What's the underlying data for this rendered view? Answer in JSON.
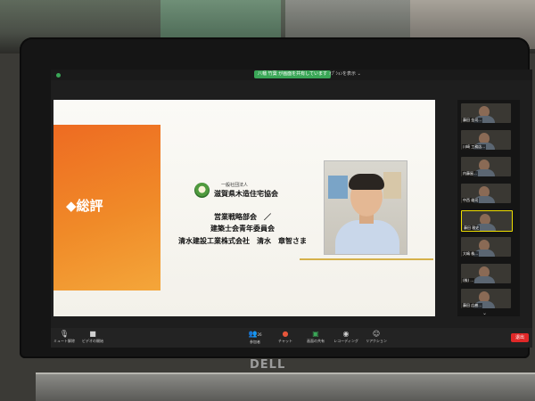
{
  "zoom": {
    "share_banner": "八幡 竹葉 が画面を共有しています",
    "view_options": "ｵﾌﾟｼｮﾝを表示 ⌄"
  },
  "slide": {
    "title": "◆総評",
    "org_small": "一般社団法人",
    "org_name": "滋賀県木造住宅協会",
    "line1": "営業戦略部会　／",
    "line2": "建築士会青年委員会",
    "line3": "清水建設工業株式会社　清水　章智さま"
  },
  "participants": [
    {
      "name": "藤田 金司..."
    },
    {
      "name": "川崎 工務店..."
    },
    {
      "name": "内藤屋..."
    },
    {
      "name": "中西 雄司"
    },
    {
      "name": "藤田 雅史"
    },
    {
      "name": "大嶋 株..."
    },
    {
      "name": "(株) ..."
    },
    {
      "name": "藤田 広樹..."
    }
  ],
  "toolbar": {
    "mute": "ミュート解除",
    "video": "ビデオの開始",
    "participants": "参加者",
    "participants_count": "26",
    "chat": "チャット",
    "share": "画面の共有",
    "record": "レコーディング",
    "reactions": "リアクション",
    "end": "退出"
  },
  "laptop": {
    "brand": "DELL"
  },
  "colors": {
    "orange": "#ee6b22",
    "zoom_green": "#3aa757",
    "end_red": "#e02828",
    "accent_gold": "#d5b14a"
  }
}
